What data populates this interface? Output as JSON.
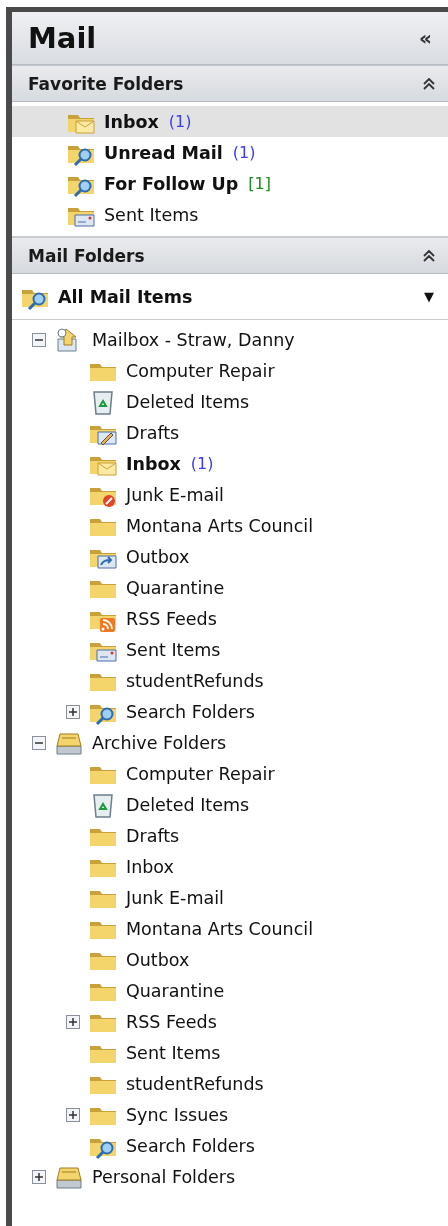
{
  "pane": {
    "title": "Mail",
    "collapse_glyph": "«"
  },
  "favorites": {
    "title": "Favorite Folders",
    "items": [
      {
        "label": "Inbox",
        "kind": "inbox",
        "count": "(1)",
        "color": "#3c3cf0",
        "selected": true
      },
      {
        "label": "Unread Mail",
        "kind": "search",
        "count": "(1)",
        "color": "#3c3cf0",
        "selected": false
      },
      {
        "label": "For Follow Up",
        "kind": "search",
        "count": "[1]",
        "color": "#1e8c1e",
        "selected": false
      },
      {
        "label": "Sent Items",
        "kind": "sent",
        "selected": false
      }
    ]
  },
  "mail_folders": {
    "title": "Mail Folders",
    "view": {
      "label": "All Mail Items",
      "caret": "▼"
    },
    "tree": [
      {
        "label": "Mailbox - Straw, Danny",
        "kind": "mailbox",
        "expanded": true,
        "children": [
          {
            "label": "Computer Repair",
            "kind": "folder"
          },
          {
            "label": "Deleted Items",
            "kind": "trash"
          },
          {
            "label": "Drafts",
            "kind": "drafts"
          },
          {
            "label": "Inbox",
            "kind": "inbox",
            "count": "(1)",
            "color": "#3c3cf0"
          },
          {
            "label": "Junk E-mail",
            "kind": "junk"
          },
          {
            "label": "Montana Arts Council",
            "kind": "folder"
          },
          {
            "label": "Outbox",
            "kind": "outbox"
          },
          {
            "label": "Quarantine",
            "kind": "folder"
          },
          {
            "label": "RSS Feeds",
            "kind": "rss"
          },
          {
            "label": "Sent Items",
            "kind": "sent"
          },
          {
            "label": "studentRefunds",
            "kind": "folder"
          },
          {
            "label": "Search Folders",
            "kind": "search",
            "expanded": false
          }
        ]
      },
      {
        "label": "Archive Folders",
        "kind": "archive",
        "expanded": true,
        "children": [
          {
            "label": "Computer Repair",
            "kind": "folder"
          },
          {
            "label": "Deleted Items",
            "kind": "trash"
          },
          {
            "label": "Drafts",
            "kind": "folder"
          },
          {
            "label": "Inbox",
            "kind": "folder"
          },
          {
            "label": "Junk E-mail",
            "kind": "folder"
          },
          {
            "label": "Montana Arts Council",
            "kind": "folder"
          },
          {
            "label": "Outbox",
            "kind": "folder"
          },
          {
            "label": "Quarantine",
            "kind": "folder"
          },
          {
            "label": "RSS Feeds",
            "kind": "folder",
            "expanded": false
          },
          {
            "label": "Sent Items",
            "kind": "folder"
          },
          {
            "label": "studentRefunds",
            "kind": "folder"
          },
          {
            "label": "Sync Issues",
            "kind": "folder",
            "expanded": false
          },
          {
            "label": "Search Folders",
            "kind": "search"
          }
        ]
      },
      {
        "label": "Personal Folders",
        "kind": "archive",
        "expanded": false
      }
    ]
  }
}
